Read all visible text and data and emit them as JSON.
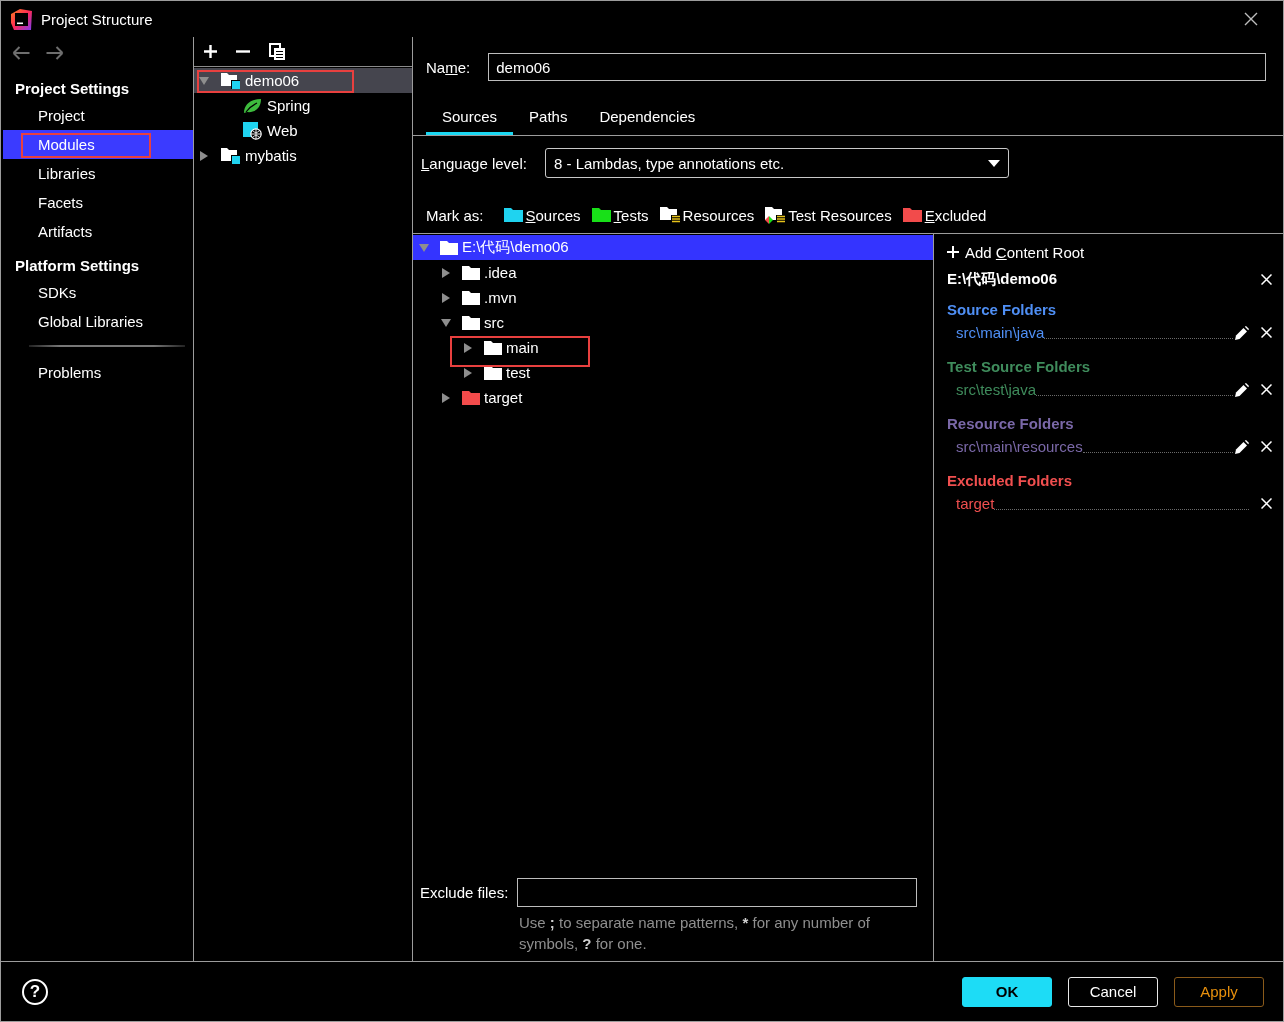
{
  "window": {
    "title": "Project Structure"
  },
  "sidebar": {
    "sections": [
      {
        "heading": "Project Settings",
        "items": [
          {
            "label": "Project",
            "selected": false,
            "annotated": false
          },
          {
            "label": "Modules",
            "selected": true,
            "annotated": true
          },
          {
            "label": "Libraries",
            "selected": false,
            "annotated": false
          },
          {
            "label": "Facets",
            "selected": false,
            "annotated": false
          },
          {
            "label": "Artifacts",
            "selected": false,
            "annotated": false
          }
        ]
      },
      {
        "heading": "Platform Settings",
        "items": [
          {
            "label": "SDKs",
            "selected": false,
            "annotated": false
          },
          {
            "label": "Global Libraries",
            "selected": false,
            "annotated": false
          }
        ]
      }
    ],
    "footer_items": [
      {
        "label": "Problems",
        "selected": false,
        "annotated": false
      }
    ]
  },
  "module_tree": {
    "items": [
      {
        "label": "demo06",
        "kind": "module",
        "expanded": true,
        "selected": true,
        "annotated": true,
        "children": [
          {
            "label": "Spring",
            "kind": "spring",
            "selected": false,
            "annotated": false
          },
          {
            "label": "Web",
            "kind": "web",
            "selected": false,
            "annotated": false
          }
        ]
      },
      {
        "label": "mybatis",
        "kind": "module",
        "expanded": false,
        "selected": false,
        "annotated": false
      }
    ]
  },
  "name_field": {
    "label": [
      {
        "text": "Na",
        "underlined": false
      },
      {
        "text": "m",
        "underlined": true
      },
      {
        "text": "e:",
        "underlined": false
      }
    ],
    "value": "demo06"
  },
  "tabs": [
    {
      "label": "Sources",
      "selected": true
    },
    {
      "label": "Paths",
      "selected": false
    },
    {
      "label": "Dependencies",
      "selected": false
    }
  ],
  "language_level": {
    "label": [
      {
        "text": "L",
        "underlined": true
      },
      {
        "text": "anguage level:",
        "underlined": false
      }
    ],
    "value": "8 - Lambdas, type annotations etc."
  },
  "mark_as": {
    "label": "Mark as:",
    "options": [
      {
        "label": [
          {
            "text": "S",
            "underlined": true
          },
          {
            "text": "ources",
            "underlined": false
          }
        ],
        "kind": "sources"
      },
      {
        "label": [
          {
            "text": "T",
            "underlined": true
          },
          {
            "text": "ests",
            "underlined": false
          }
        ],
        "kind": "tests"
      },
      {
        "label": [
          {
            "text": "Resources",
            "underlined": false
          }
        ],
        "kind": "resources"
      },
      {
        "label": [
          {
            "text": "Test Resources",
            "underlined": false
          }
        ],
        "kind": "test_resources"
      },
      {
        "label": [
          {
            "text": "E",
            "underlined": true
          },
          {
            "text": "xcluded",
            "underlined": false
          }
        ],
        "kind": "excluded"
      }
    ]
  },
  "content_tree": {
    "items": [
      {
        "label": "E:\\代码\\demo06",
        "kind": "folder",
        "expanded": true,
        "selected": true,
        "annotated": false,
        "children": [
          {
            "label": ".idea",
            "kind": "folder",
            "expanded": false,
            "selected": false,
            "annotated": false
          },
          {
            "label": ".mvn",
            "kind": "folder",
            "expanded": false,
            "selected": false,
            "annotated": false
          },
          {
            "label": "src",
            "kind": "folder",
            "expanded": true,
            "selected": false,
            "annotated": false,
            "children": [
              {
                "label": "main",
                "kind": "folder",
                "expanded": false,
                "selected": false,
                "annotated": true
              },
              {
                "label": "test",
                "kind": "folder",
                "expanded": false,
                "selected": false,
                "annotated": false
              }
            ]
          },
          {
            "label": "target",
            "kind": "excluded",
            "expanded": false,
            "selected": false,
            "annotated": false
          }
        ]
      }
    ]
  },
  "content_roots": {
    "add_label": [
      {
        "text": "Add ",
        "underlined": false
      },
      {
        "text": "C",
        "underlined": true
      },
      {
        "text": "ontent Root",
        "underlined": false
      }
    ],
    "root_path": "E:\\代码\\demo06",
    "groups": [
      {
        "heading": "Source Folders",
        "color": "#4f8ff5",
        "paths": [
          {
            "path": "src\\main\\java",
            "editable": true
          }
        ]
      },
      {
        "heading": "Test Source Folders",
        "color": "#3f8c5c",
        "paths": [
          {
            "path": "src\\test\\java",
            "editable": true
          }
        ]
      },
      {
        "heading": "Resource Folders",
        "color": "#7a68a8",
        "paths": [
          {
            "path": "src\\main\\resources",
            "editable": true
          }
        ]
      },
      {
        "heading": "Excluded Folders",
        "color": "#f04f4f",
        "paths": [
          {
            "path": "target",
            "editable": false
          }
        ]
      }
    ]
  },
  "exclude_files": {
    "label": "Exclude files:",
    "hint": [
      {
        "text": "Use ",
        "bold": false
      },
      {
        "text": ";",
        "bold": true
      },
      {
        "text": " to separate name patterns, ",
        "bold": false
      },
      {
        "text": "*",
        "bold": true
      },
      {
        "text": " for any number of symbols, ",
        "bold": false
      },
      {
        "text": "?",
        "bold": true
      },
      {
        "text": " for one.",
        "bold": false
      }
    ]
  },
  "help_button": {
    "label": "?"
  },
  "buttons": [
    {
      "label": "OK",
      "kind": "primary",
      "disabled": false
    },
    {
      "label": "Cancel",
      "kind": "default",
      "disabled": false
    },
    {
      "label": "Apply",
      "kind": "default",
      "disabled": true
    }
  ]
}
